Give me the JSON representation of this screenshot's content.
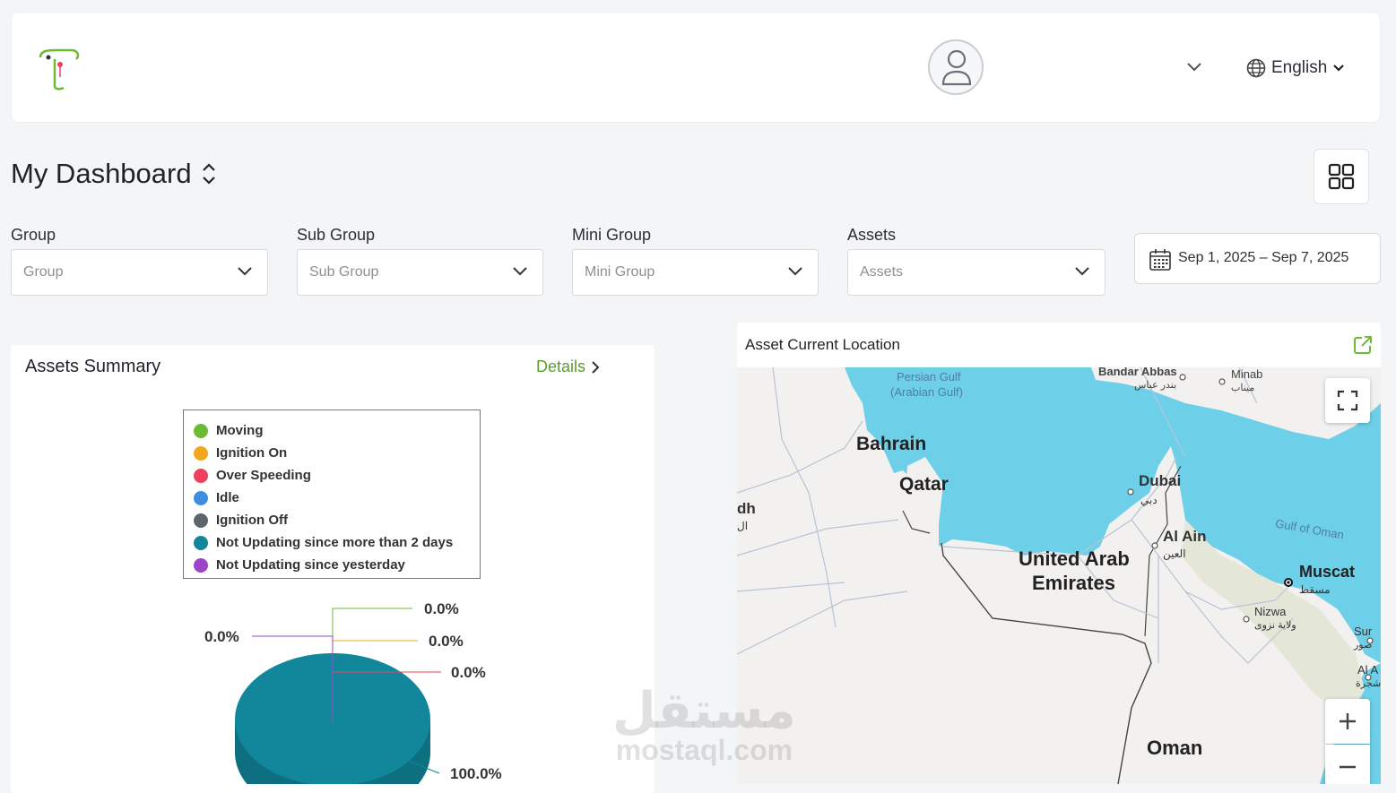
{
  "header": {
    "language": "English"
  },
  "page": {
    "title": "My Dashboard"
  },
  "filters": [
    {
      "label": "Group",
      "placeholder": "Group"
    },
    {
      "label": "Sub Group",
      "placeholder": "Sub Group"
    },
    {
      "label": "Mini Group",
      "placeholder": "Mini Group"
    },
    {
      "label": "Assets",
      "placeholder": "Assets"
    }
  ],
  "date_range": "Sep 1, 2025 – Sep 7, 2025",
  "summary": {
    "title": "Assets Summary",
    "details_label": "Details",
    "legend": [
      {
        "label": "Moving",
        "color": "#6dbb35"
      },
      {
        "label": "Ignition On",
        "color": "#f2a81d"
      },
      {
        "label": "Over Speeding",
        "color": "#ef3f5f"
      },
      {
        "label": "Idle",
        "color": "#3f8fe0"
      },
      {
        "label": "Ignition Off",
        "color": "#5f656e"
      },
      {
        "label": "Not Updating since more than 2 days",
        "color": "#12879c"
      },
      {
        "label": "Not Updating since yesterday",
        "color": "#9b45c8"
      }
    ],
    "pie_labels": {
      "moving": "0.0%",
      "ignition_on": "0.0%",
      "over_speeding": "0.0%",
      "not_updating_yesterday": "0.0%",
      "not_updating_2days": "100.0%"
    }
  },
  "map": {
    "title": "Asset Current Location",
    "labels": {
      "persian_gulf": "Persian Gulf",
      "arabian_gulf": "(Arabian Gulf)",
      "bandar_abbas": "Bandar Abbas",
      "bandar_abbas_ar": "بندر عباس",
      "minab": "Minab",
      "minab_ar": "میناب",
      "bahrain": "Bahrain",
      "qatar": "Qatar",
      "dubai": "Dubai",
      "dubai_ar": "دبي",
      "dh": "dh",
      "dh_ar": "ال",
      "al_ain": "Al Ain",
      "al_ain_ar": "العين",
      "uae1": "United Arab",
      "uae2": "Emirates",
      "gulf_oman": "Gulf of Oman",
      "muscat": "Muscat",
      "muscat_ar": "مسقط",
      "nizwa": "Nizwa",
      "nizwa_ar": "ولاية نزوى",
      "sur": "Sur",
      "sur_ar": "صور",
      "al_a": "Al A",
      "al_a_ar": "شجرة",
      "oman": "Oman"
    }
  },
  "watermark": {
    "arabic": "مستقل",
    "latin": "mostaql.com"
  }
}
